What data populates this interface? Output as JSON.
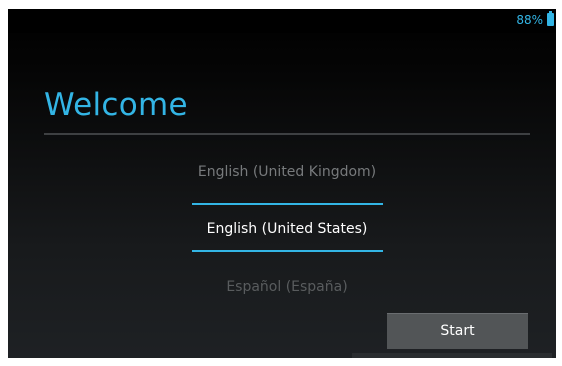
{
  "status_bar": {
    "battery_percent": "88%",
    "battery_icon": "battery-full-icon"
  },
  "welcome": {
    "title": "Welcome"
  },
  "language_picker": {
    "previous": "English (United Kingdom)",
    "selected": "English (United States)",
    "next": "Español (España)"
  },
  "actions": {
    "start_label": "Start"
  },
  "colors": {
    "accent": "#33b5e5",
    "background": "#000000",
    "button": "#525557"
  }
}
